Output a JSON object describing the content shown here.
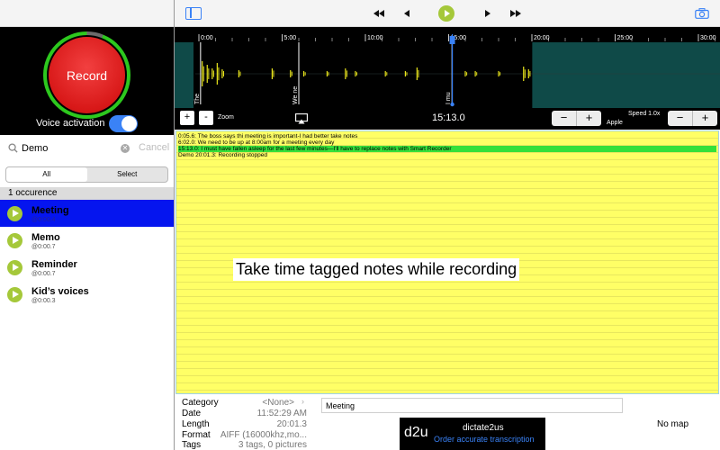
{
  "record": {
    "label": "Record",
    "voice_activation_label": "Voice activation",
    "voice_activation_on": true
  },
  "search": {
    "value": "Demo",
    "cancel_label": "Cancel"
  },
  "segments": {
    "all": "All",
    "select": "Select",
    "selected": "All"
  },
  "occurrence_header": "1 occurence",
  "tags": [
    {
      "name": "Meeting",
      "time": "@0:00.4",
      "selected": true
    },
    {
      "name": "Memo",
      "time": "@0:00.7",
      "selected": false
    },
    {
      "name": "Reminder",
      "time": "@0:00.7",
      "selected": false
    },
    {
      "name": "Kid’s voices",
      "time": "@0:00.3",
      "selected": false
    }
  ],
  "timeline": {
    "ticks": [
      "0:00",
      "5:00",
      "10:00",
      "15:00",
      "20:00",
      "25:00",
      "30:00"
    ],
    "total_minutes": 30,
    "duration_minutes": 20.02,
    "playhead_minutes": 15.22,
    "markers": [
      {
        "label": "The",
        "minute": 0.1
      },
      {
        "label": "We ne",
        "minute": 6.0
      },
      {
        "label": "I mu",
        "minute": 15.2
      }
    ],
    "colors": {
      "recorded": "#000000",
      "unrecorded": "#0f4a48",
      "waveform": "#e8e41c",
      "playhead": "#3a82f6"
    }
  },
  "controls": {
    "zoom_in": "+",
    "zoom_out": "-",
    "zoom_label": "Zoom",
    "current_time": "15:13.0",
    "voice_name": "Apple",
    "speed_label": "Speed 1.0x",
    "minus": "−",
    "plus": "+"
  },
  "notes": [
    {
      "text": "0:05.6:  The boss says thi meeting is important-I had better take notes",
      "highlight": false
    },
    {
      "text": "6:02.0: We need to be up at 8:00am for a meeting every day",
      "highlight": false
    },
    {
      "text": "15:13.0:  I must have fallen asleep for the last few minutes—I’ll have to replace notes with Smart Recorder",
      "highlight": true
    },
    {
      "text": "Demo 20:01.3: Recording stopped",
      "highlight": false
    }
  ],
  "caption": "Take time tagged notes while recording",
  "info": {
    "category_label": "Category",
    "category_value": "<None>",
    "date_label": "Date",
    "date_value": "11:52:29 AM",
    "length_label": "Length",
    "length_value": "20:01.3",
    "format_label": "Format",
    "format_value": "AIFF (16000khz,mo...",
    "tags_label": "Tags",
    "tags_value": "3 tags, 0 pictures",
    "title_value": "Meeting"
  },
  "banner": {
    "logo": "d2u",
    "name": "dictate2us",
    "subtitle": "Order accurate transcription"
  },
  "map_text": "No map"
}
